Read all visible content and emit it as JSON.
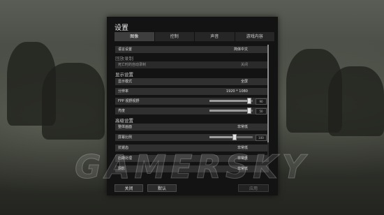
{
  "dialog": {
    "title": "设置",
    "tabs": [
      {
        "label": "图像",
        "active": true
      },
      {
        "label": "控制",
        "active": false
      },
      {
        "label": "声音",
        "active": false
      },
      {
        "label": "游戏内容",
        "active": false
      }
    ]
  },
  "settings": {
    "language": {
      "label": "语言设置",
      "value": "简体中文"
    },
    "section_record": "回放录制",
    "record": {
      "label": "死亡时的自动录制",
      "value": "关闭"
    },
    "section_display": "显示设置",
    "display_mode": {
      "label": "显示模式",
      "value": "全屏"
    },
    "resolution": {
      "label": "分辨率",
      "value": "1920 * 1080"
    },
    "fpp_fov": {
      "label": "FPP 视野视野",
      "level": 0.92,
      "value": "90"
    },
    "brightness": {
      "label": "亮度",
      "level": 0.92,
      "value": "50"
    },
    "section_advanced": "高级设置",
    "overall_quality": {
      "label": "整体画面",
      "value": "非常低"
    },
    "screen_scale": {
      "label": "屏幕比例",
      "level": 0.58,
      "value": "100"
    },
    "anti_aliasing": {
      "label": "抗锯齿",
      "value": "非常低"
    },
    "post_processing": {
      "label": "后期处理",
      "value": "非常低"
    },
    "shadows": {
      "label": "阴影",
      "value": "非常低"
    }
  },
  "buttons": {
    "close": "关闭",
    "default": "默认",
    "apply": "应用"
  },
  "watermark": "GAMERSKY"
}
